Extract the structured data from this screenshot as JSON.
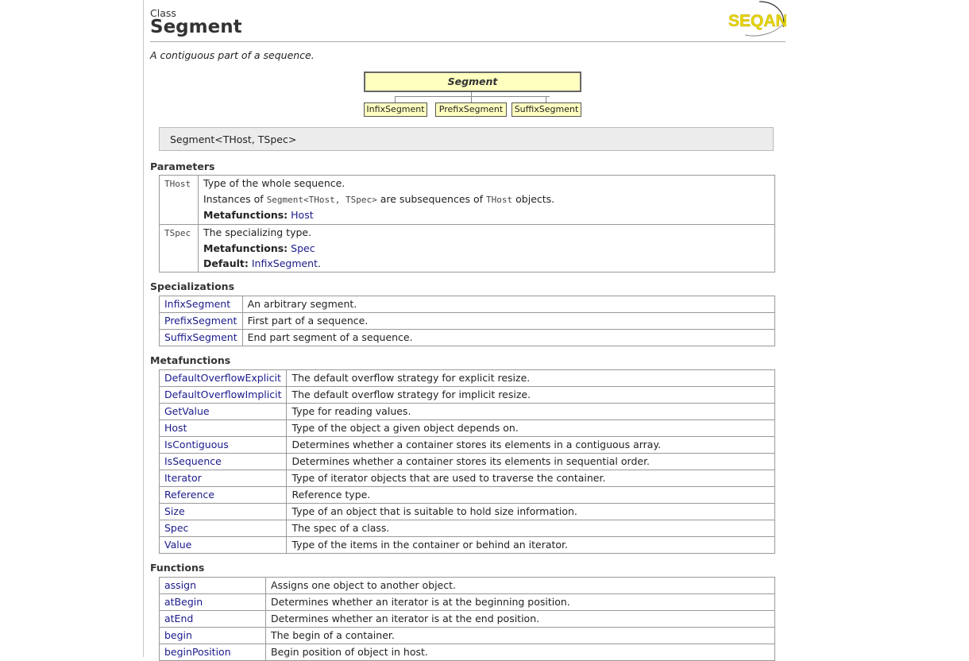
{
  "header": {
    "kind": "Class",
    "title": "Segment",
    "brief": "A contiguous part of a sequence.",
    "logo_text": "SEQAN"
  },
  "diagram": {
    "main": "Segment",
    "children": [
      "InfixSegment",
      "PrefixSegment",
      "SuffixSegment"
    ]
  },
  "signature": "Segment<THost, TSpec>",
  "sections": {
    "parameters": "Parameters",
    "specializations": "Specializations",
    "metafunctions": "Metafunctions",
    "functions": "Functions"
  },
  "parameters": [
    {
      "name": "THost",
      "desc": "Type of the whole sequence.",
      "note_pre": "Instances of ",
      "note_code1": "Segment<THost, TSpec>",
      "note_mid": " are subsequences of ",
      "note_code2": "THost",
      "note_post": " objects.",
      "meta_label": "Metafunctions:",
      "meta_link": "Host"
    },
    {
      "name": "TSpec",
      "desc": "The specializing type.",
      "meta_label": "Metafunctions:",
      "meta_link": "Spec",
      "default_label": "Default:",
      "default_link": "InfixSegment",
      "default_post": "."
    }
  ],
  "specializations": [
    {
      "name": "InfixSegment",
      "desc": "An arbitrary segment."
    },
    {
      "name": "PrefixSegment",
      "desc": "First part of a sequence."
    },
    {
      "name": "SuffixSegment",
      "desc": "End part segment of a sequence."
    }
  ],
  "metafunctions": [
    {
      "name": "DefaultOverflowExplicit",
      "desc": "The default overflow strategy for explicit resize."
    },
    {
      "name": "DefaultOverflowImplicit",
      "desc": "The default overflow strategy for implicit resize."
    },
    {
      "name": "GetValue",
      "desc": "Type for reading values."
    },
    {
      "name": "Host",
      "desc": "Type of the object a given object depends on."
    },
    {
      "name": "IsContiguous",
      "desc": "Determines whether a container stores its elements in a contiguous array."
    },
    {
      "name": "IsSequence",
      "desc": "Determines whether a container stores its elements in sequential order."
    },
    {
      "name": "Iterator",
      "desc": "Type of iterator objects that are used to traverse the container."
    },
    {
      "name": "Reference",
      "desc": "Reference type."
    },
    {
      "name": "Size",
      "desc": "Type of an object that is suitable to hold size information."
    },
    {
      "name": "Spec",
      "desc": "The spec of a class."
    },
    {
      "name": "Value",
      "desc": "Type of the items in the container or behind an iterator."
    }
  ],
  "functions": [
    {
      "name": "assign",
      "desc": "Assigns one object to another object."
    },
    {
      "name": "atBegin",
      "desc": "Determines whether an iterator is at the beginning position."
    },
    {
      "name": "atEnd",
      "desc": "Determines whether an iterator is at the end position."
    },
    {
      "name": "begin",
      "desc": "The begin of a container."
    },
    {
      "name": "beginPosition",
      "desc": "Begin position of object in host."
    }
  ],
  "colors": {
    "link": "#1a1a8c",
    "diagram_fill": "#ffffc0",
    "logo_yellow": "#e8d500"
  }
}
